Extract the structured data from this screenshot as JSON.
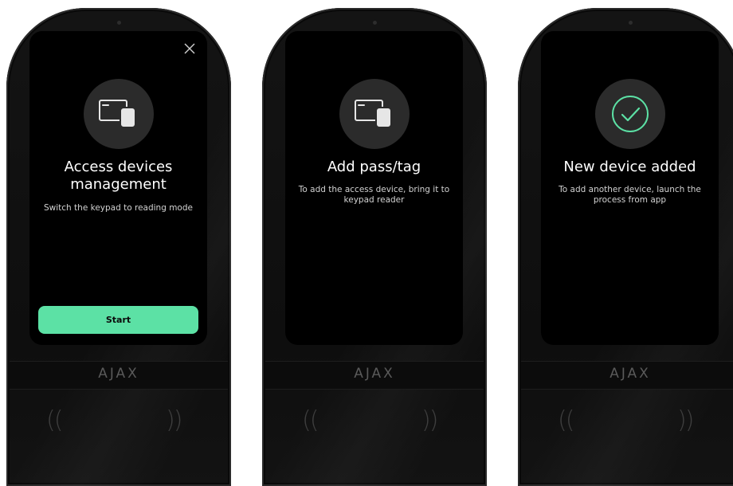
{
  "brand": "AJAX",
  "accent_color": "#5ce1a5",
  "panels": [
    {
      "icon": "card-and-tag-icon",
      "show_close": true,
      "title": "Access devices management",
      "description": "Switch the keypad to reading mode",
      "button_label": "Start"
    },
    {
      "icon": "card-and-tag-icon",
      "title": "Add pass/tag",
      "description": "To add the access device, bring it to keypad reader"
    },
    {
      "icon": "checkmark-icon",
      "title": "New device added",
      "description": "To add another device, launch the process from app"
    }
  ],
  "reader_indicator": {
    "left": "((",
    "right": "))"
  }
}
